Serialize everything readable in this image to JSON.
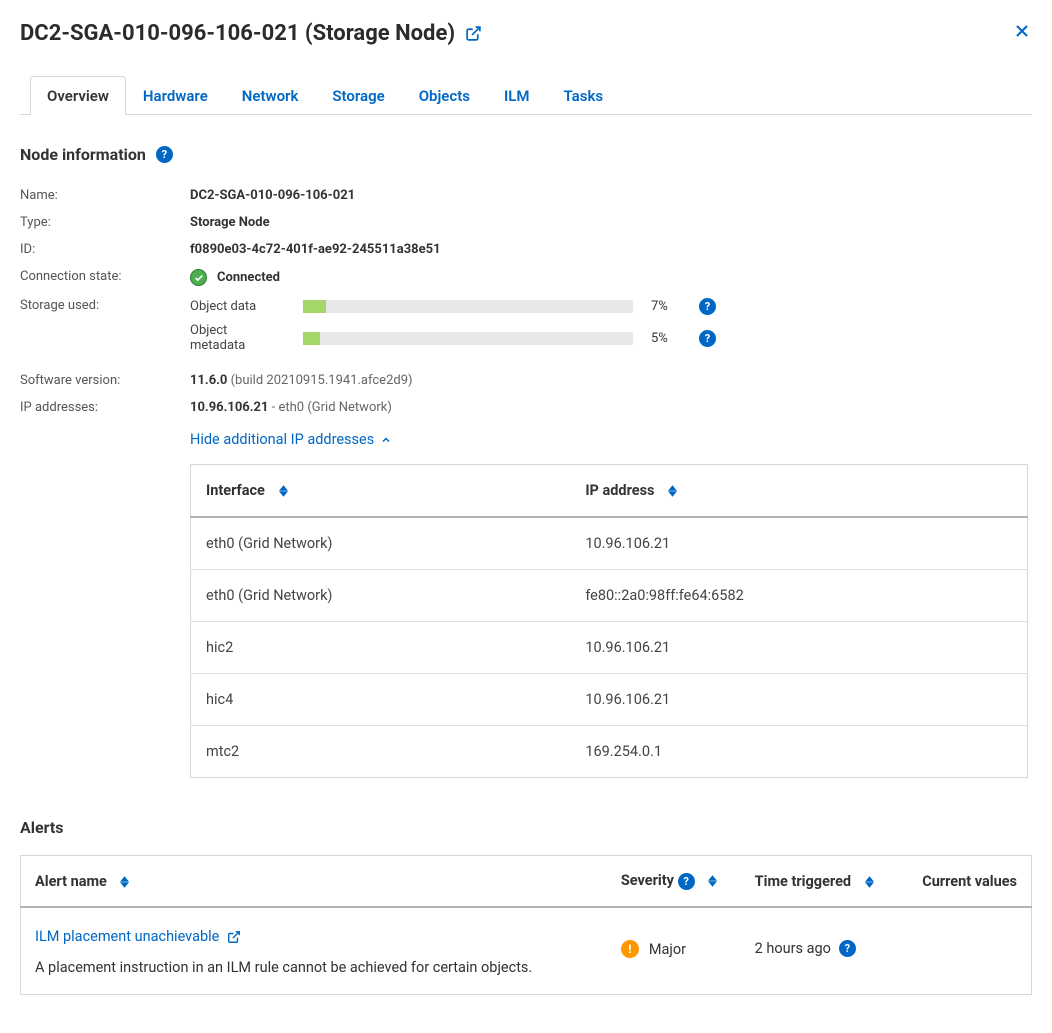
{
  "header": {
    "title": "DC2-SGA-010-096-106-021 (Storage Node)"
  },
  "tabs": [
    "Overview",
    "Hardware",
    "Network",
    "Storage",
    "Objects",
    "ILM",
    "Tasks"
  ],
  "section_node_info": "Node information",
  "info": {
    "name_label": "Name:",
    "name_value": "DC2-SGA-010-096-106-021",
    "type_label": "Type:",
    "type_value": "Storage Node",
    "id_label": "ID:",
    "id_value": "f0890e03-4c72-401f-ae92-245511a38e51",
    "conn_label": "Connection state:",
    "conn_value": "Connected",
    "storage_label": "Storage used:",
    "version_label": "Software version:",
    "version_value": "11.6.0",
    "version_detail": "(build 20210915.1941.afce2d9)",
    "ip_label": "IP addresses:",
    "ip_value": "10.96.106.21",
    "ip_detail": " - eth0 (Grid Network)"
  },
  "storage": {
    "object_data_label": "Object data",
    "object_data_pct": "7%",
    "object_meta_label": "Object metadata",
    "object_meta_pct": "5%"
  },
  "toggle_link": "Hide additional IP addresses",
  "ip_table_headers": {
    "interface": "Interface",
    "ip": "IP address"
  },
  "ip_rows": [
    {
      "if": "eth0 (Grid Network)",
      "ip": "10.96.106.21"
    },
    {
      "if": "eth0 (Grid Network)",
      "ip": "fe80::2a0:98ff:fe64:6582"
    },
    {
      "if": "hic2",
      "ip": "10.96.106.21"
    },
    {
      "if": "hic4",
      "ip": "10.96.106.21"
    },
    {
      "if": "mtc2",
      "ip": "169.254.0.1"
    }
  ],
  "alerts": {
    "title": "Alerts",
    "headers": {
      "name": "Alert name",
      "severity": "Severity",
      "time": "Time triggered",
      "values": "Current values"
    },
    "rows": [
      {
        "name": "ILM placement unachievable",
        "desc": "A placement instruction in an ILM rule cannot be achieved for certain objects.",
        "severity": "Major",
        "time": "2 hours ago"
      }
    ]
  }
}
